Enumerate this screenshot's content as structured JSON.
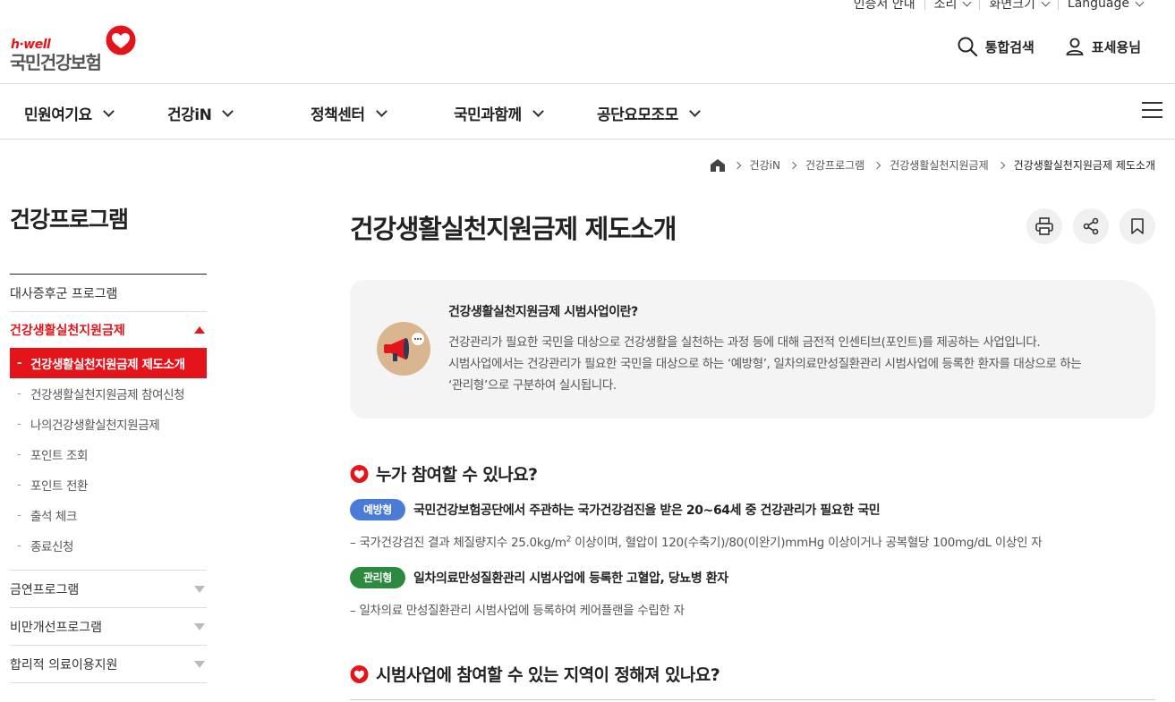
{
  "utility": {
    "cert": "인증서 안내",
    "sound": "소리",
    "screen": "화면크기",
    "language": "Language"
  },
  "logo": {
    "hwell": "h·well",
    "name": "국민건강보험"
  },
  "header": {
    "search": "통합검색",
    "user": "표세용님"
  },
  "gnb": [
    "민원여기요",
    "건강iN",
    "정책센터",
    "국민과함께",
    "공단요모조모"
  ],
  "breadcrumb": [
    "건강iN",
    "건강프로그램",
    "건강생활실천지원금제",
    "건강생활실천지원금제 제도소개"
  ],
  "sidebar": {
    "title": "건강프로그램",
    "items": [
      {
        "label": "대사증후군 프로그램"
      },
      {
        "label": "건강생활실천지원금제"
      },
      {
        "label": "금연프로그램"
      },
      {
        "label": "비만개선프로그램"
      },
      {
        "label": "합리적 의료이용지원"
      }
    ],
    "sub": [
      "건강생활실천지원금제 제도소개",
      "건강생활실천지원금제 참여신청",
      "나의건강생활실천지원금제",
      "포인트 조회",
      "포인트 전환",
      "출석 체크",
      "종료신청"
    ]
  },
  "page": {
    "title": "건강생활실천지원금제 제도소개"
  },
  "intro": {
    "question": "건강생활실천지원금제 시범사업이란?",
    "line1": "건강관리가 필요한 국민을 대상으로 건강생활을 실천하는 과정 등에 대해 금전적 인센티브(포인트)를 제공하는 사업입니다.",
    "line2": "시범사업에서는 건강관리가 필요한 국민을 대상으로 하는 ‘예방형’, 일차의료만성질환관리 시범사업에 등록한 환자를 대상으로 하는",
    "line3": "‘관리형’으로 구분하여 실시됩니다."
  },
  "section1": {
    "title": "누가 참여할 수 있나요?",
    "prevent": {
      "badge": "예방형",
      "text": "국민건강보험공단에서 주관하는 국가건강검진을 받은 20~64세 중 건강관리가 필요한 국민",
      "desc_a": "– 국가건강검진 결과 체질량지수 25.0kg/m",
      "desc_sup": "2",
      "desc_b": " 이상이며, 혈압이 120(수축기)/80(이완기)mmHg 이상이거나 공복혈당 100mg/dL 이상인 자"
    },
    "manage": {
      "badge": "관리형",
      "text": "일차의료만성질환관리 시범사업에 등록한 고혈압, 당뇨병 환자",
      "desc": "– 일차의료 만성질환관리 시범사업에 등록하여 케어플랜을 수립한 자"
    }
  },
  "section2": {
    "title": "시범사업에 참여할 수 있는 지역이 정해져 있나요?"
  }
}
